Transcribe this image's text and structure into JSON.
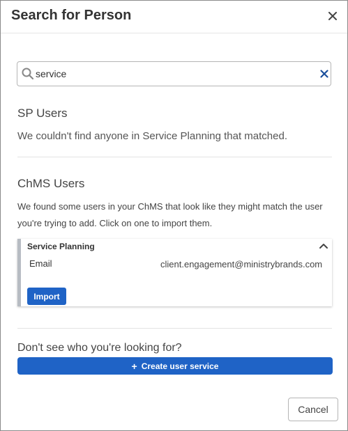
{
  "modal": {
    "title": "Search for Person",
    "close_label": "×"
  },
  "search": {
    "value": "service",
    "placeholder": ""
  },
  "sp_users": {
    "heading": "SP Users",
    "message": "We couldn't find anyone in Service Planning that matched."
  },
  "chms_users": {
    "heading": "ChMS Users",
    "message": "We found some users in your ChMS that look like they might match the user you're trying to add. Click on one to import them.",
    "result": {
      "title": "Service Planning",
      "field_label": "Email",
      "field_value": "client.engagement@ministrybrands.com",
      "import_label": "Import"
    }
  },
  "footer": {
    "prompt": "Don't see who you're looking for?",
    "create_label": "Create user service",
    "cancel_label": "Cancel"
  },
  "colors": {
    "primary": "#1f63c6",
    "card_accent": "#b7bcc3"
  },
  "icons": {
    "search": "search-icon",
    "clear": "clear-icon",
    "close": "close-icon",
    "chevron": "chevron-up-icon",
    "plus": "plus-icon"
  }
}
